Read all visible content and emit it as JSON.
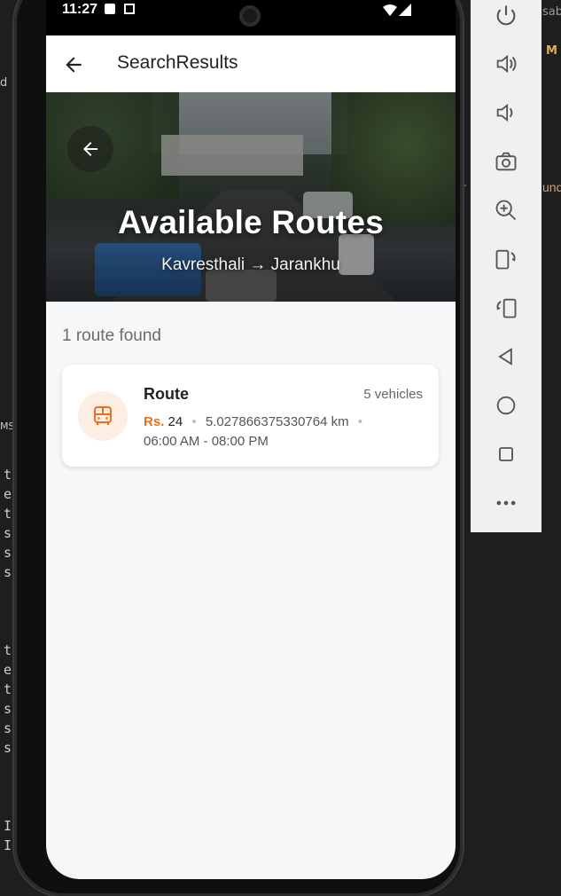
{
  "status_bar": {
    "time": "11:27"
  },
  "app_bar": {
    "title": "SearchResults"
  },
  "hero": {
    "title": "Available Routes",
    "subtitle": "Kavresthali → Jarankhu"
  },
  "results": {
    "count_text": "1 route found",
    "cards": [
      {
        "name": "Route",
        "vehicles": "5 vehicles",
        "currency": "Rs.",
        "price": "24",
        "distance": "5.027866375330764 km",
        "hours": "06:00 AM - 08:00 PM"
      }
    ]
  },
  "emulator_toolbar": {
    "buttons": [
      "power-icon",
      "volume-up-icon",
      "volume-down-icon",
      "camera-icon",
      "zoom-in-icon",
      "rotate-left-icon",
      "rotate-right-icon",
      "back-triangle-icon",
      "home-circle-icon",
      "overview-square-icon",
      "more-icon"
    ]
  },
  "background_editor": {
    "left_chars": [
      "d",
      "to",
      "eq",
      "to",
      "s",
      "s",
      "s",
      "to",
      "eq",
      "to",
      "s",
      "s",
      "s",
      "I",
      "I"
    ],
    "top_right_label": "M",
    "top_right_text": "sabr",
    "side_text": "r",
    "side_text_right": "und",
    "ms_label": "MS"
  },
  "colors": {
    "accent": "#ef6c1e",
    "app_background": "#f6f7f9",
    "card_background": "#ffffff"
  }
}
